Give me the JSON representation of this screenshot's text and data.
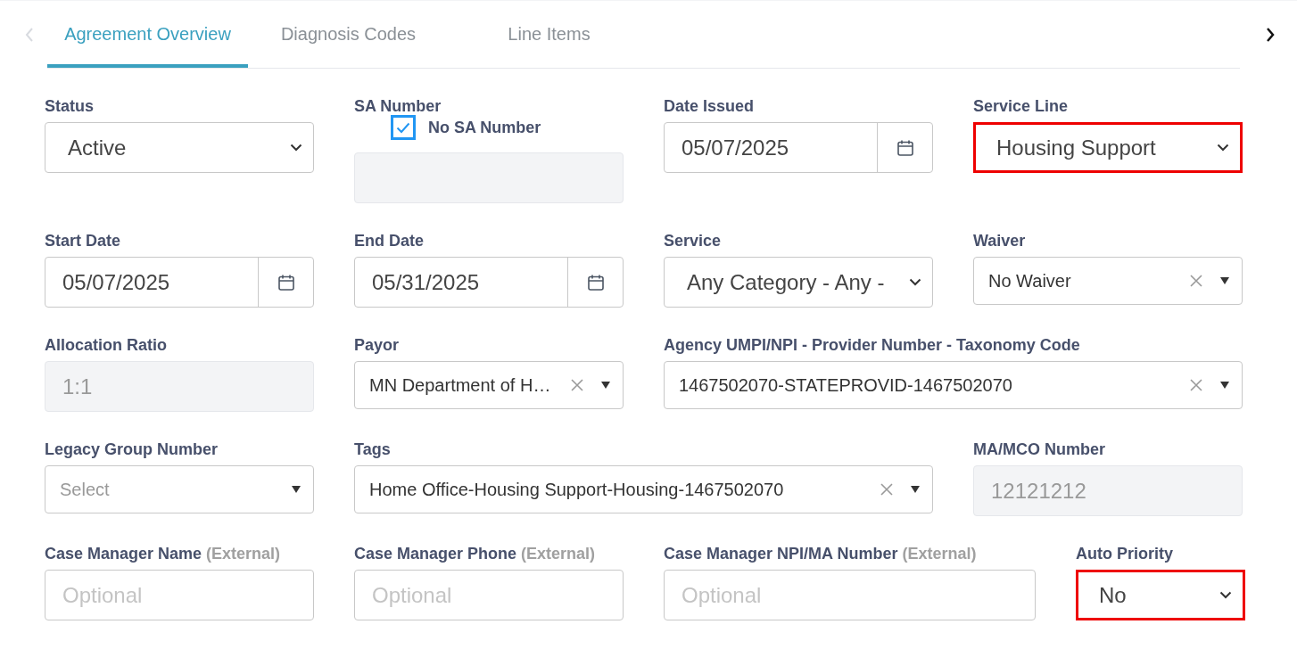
{
  "tabs": [
    {
      "label": "Agreement Overview",
      "selected": true
    },
    {
      "label": "Diagnosis Codes",
      "selected": false
    },
    {
      "label": "Line Items",
      "selected": false
    }
  ],
  "rows": [
    [
      {
        "kind": "select",
        "label": "Status",
        "value": "Active",
        "highlighted": false
      },
      {
        "kind": "checkbox_text",
        "label": "SA Number",
        "checkbox": {
          "label": "No SA Number",
          "checked": true
        },
        "disabled": true
      },
      {
        "kind": "date",
        "label": "Date Issued",
        "value": "05/07/2025"
      },
      {
        "kind": "select",
        "label": "Service Line",
        "value": "Housing Support",
        "highlighted": true
      }
    ],
    [
      {
        "kind": "date",
        "label": "Start Date",
        "value": "05/07/2025"
      },
      {
        "kind": "date",
        "label": "End Date",
        "value": "05/31/2025"
      },
      {
        "kind": "select",
        "label": "Service",
        "value": "Any Category - Any -",
        "highlighted": false
      },
      {
        "kind": "combo",
        "label": "Waiver",
        "value": "No Waiver"
      }
    ],
    [
      {
        "kind": "text",
        "label": "Allocation Ratio",
        "value": "1:1",
        "disabled": true
      },
      {
        "kind": "combo",
        "label": "Payor",
        "value": "MN Department of H…"
      },
      {
        "kind": "combo",
        "label": "Agency UMPI/NPI - Provider Number - Taxonomy Code",
        "value": "1467502070-STATEPROVID-1467502070"
      }
    ],
    [
      {
        "kind": "combo",
        "label": "Legacy Group Number",
        "placeholder": "Select"
      },
      {
        "kind": "combo",
        "label": "Tags",
        "value": "Home Office-Housing Support-Housing-1467502070"
      },
      {
        "kind": "text",
        "label": "MA/MCO Number",
        "value": "12121212",
        "disabled": true
      }
    ],
    [
      {
        "kind": "text",
        "label": "Case Manager Name",
        "note": "(External)",
        "placeholder": "Optional",
        "disabled": false
      },
      {
        "kind": "text",
        "label": "Case Manager Phone",
        "note": "(External)",
        "placeholder": "Optional",
        "disabled": false
      },
      {
        "kind": "text",
        "label": "Case Manager NPI/MA Number",
        "note": "(External)",
        "placeholder": "Optional",
        "disabled": false
      },
      {
        "kind": "select",
        "label": "Auto Priority",
        "value": "No",
        "highlighted": true
      }
    ]
  ]
}
